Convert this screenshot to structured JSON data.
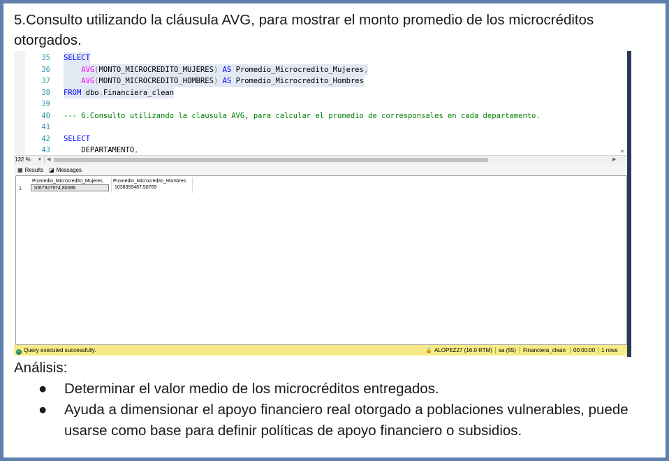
{
  "heading": "5.Consulto utilizando la cláusula AVG, para mostrar el monto promedio de los microcréditos otorgados.",
  "editor": {
    "lines": [
      {
        "num": "35",
        "parts": [
          {
            "t": "SELECT",
            "c": "kw"
          }
        ]
      },
      {
        "num": "36",
        "parts": [
          {
            "t": "    ",
            "c": "tx"
          },
          {
            "t": "AVG",
            "c": "fn"
          },
          {
            "t": "(",
            "c": "gr"
          },
          {
            "t": "MONTO_MICROCREDITO_MUJERES",
            "c": "tx"
          },
          {
            "t": ")",
            "c": "gr"
          },
          {
            "t": " AS ",
            "c": "kw"
          },
          {
            "t": "Promedio_Microcredito_Mujeres",
            "c": "tx"
          },
          {
            "t": ",",
            "c": "gr"
          }
        ]
      },
      {
        "num": "37",
        "parts": [
          {
            "t": "    ",
            "c": "tx"
          },
          {
            "t": "AVG",
            "c": "fn"
          },
          {
            "t": "(",
            "c": "gr"
          },
          {
            "t": "MONTO_MICROCREDITO_HOMBRES",
            "c": "tx"
          },
          {
            "t": ")",
            "c": "gr"
          },
          {
            "t": " AS ",
            "c": "kw"
          },
          {
            "t": "Promedio_Microcredito_Hombres",
            "c": "tx"
          }
        ]
      },
      {
        "num": "38",
        "parts": [
          {
            "t": "FROM",
            "c": "kw"
          },
          {
            "t": " dbo",
            "c": "tx"
          },
          {
            "t": ".",
            "c": "gr"
          },
          {
            "t": "Financiera_clean",
            "c": "tx"
          }
        ]
      },
      {
        "num": "39",
        "parts": []
      },
      {
        "num": "40",
        "parts": [
          {
            "t": "--- 6.Consulto utilizando la clausula AVG, para calcular el promedio de corresponsales en cada departamento.",
            "c": "cm"
          }
        ]
      },
      {
        "num": "41",
        "parts": []
      },
      {
        "num": "42",
        "parts": [
          {
            "t": "SELECT",
            "c": "kw"
          }
        ]
      },
      {
        "num": "43",
        "parts": [
          {
            "t": "    DEPARTAMENTO",
            "c": "tx"
          },
          {
            "t": ",",
            "c": "gr"
          }
        ]
      }
    ],
    "highlighted_lines": [
      "35",
      "36",
      "37",
      "38"
    ]
  },
  "zoom": "132 %",
  "tabs": {
    "results": "Results",
    "messages": "Messages"
  },
  "results": {
    "columns": [
      "Promedio_Microcredito_Mujeres",
      "Promedio_Microcredito_Hombres"
    ],
    "rows": [
      {
        "num": "1",
        "cells": [
          "1067927974,80086",
          "1038359487,50769"
        ]
      }
    ]
  },
  "status": {
    "message": "Query executed successfully.",
    "server": "ALOPEZ27 (16.0 RTM)",
    "user": "sa (55)",
    "database": "Financiera_clean",
    "time": "00:00:00",
    "rows": "1 rows"
  },
  "analysis": {
    "label": "Análisis:",
    "bullets": [
      "Determinar el valor medio de los microcréditos entregados.",
      "Ayuda a dimensionar el apoyo financiero real otorgado a poblaciones vulnerables, puede usarse como base para definir políticas de apoyo financiero o subsidios."
    ]
  },
  "colors": {
    "frame": "#5f7faf",
    "keyword": "#0000ff",
    "function": "#ff00ff",
    "comment": "#008000",
    "line_number": "#2b91af",
    "status_bar": "#f6eb86"
  }
}
